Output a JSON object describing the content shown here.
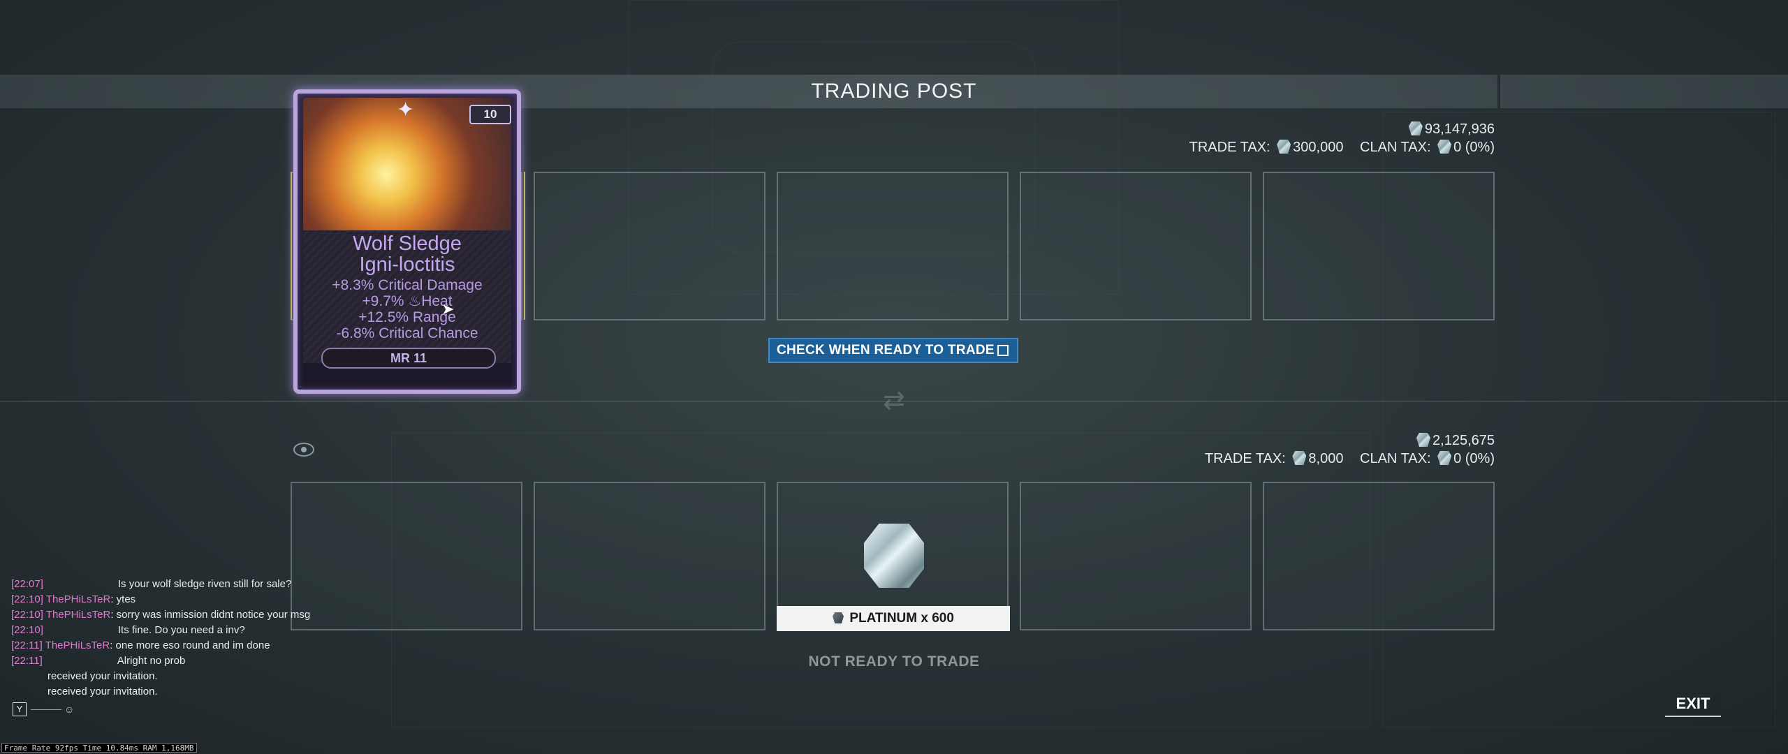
{
  "window": {
    "title": "TRADING POST"
  },
  "top_panel": {
    "balance": "93,147,936",
    "trade_tax_label": "TRADE TAX:",
    "trade_tax_value": "300,000",
    "clan_tax_label": "CLAN TAX:",
    "clan_tax_value": "0 (0%)"
  },
  "riven": {
    "rank": "10",
    "weapon": "Wolf Sledge",
    "mod_name": "Igni-loctitis",
    "stats": [
      "+8.3% Critical Damage",
      "+9.7% ♨Heat",
      "+12.5% Range",
      "-6.8% Critical Chance"
    ],
    "mastery": "MR 11"
  },
  "ready_button": {
    "label": "CHECK WHEN READY TO TRADE"
  },
  "bottom_panel": {
    "balance": "2,125,675",
    "trade_tax_label": "TRADE TAX:",
    "trade_tax_value": "8,000",
    "clan_tax_label": "CLAN TAX:",
    "clan_tax_value": "0 (0%)",
    "item_label": "PLATINUM x 600",
    "status": "NOT READY TO TRADE"
  },
  "exit_button": {
    "label": "EXIT"
  },
  "chat": [
    {
      "time": "[22:07]",
      "user": "",
      "msg": "Is your wolf sledge riven still for sale?"
    },
    {
      "time": "[22:10]",
      "user": "ThePHiLsTeR",
      "msg": ": ytes"
    },
    {
      "time": "[22:10]",
      "user": "ThePHiLsTeR",
      "msg": ": sorry was inmission didnt notice your msg"
    },
    {
      "time": "[22:10]",
      "user": "",
      "msg": "Its fine. Do you need a inv?"
    },
    {
      "time": "[22:11]",
      "user": "ThePHiLsTeR",
      "msg": ": one more eso round and im done"
    },
    {
      "time": "[22:11]",
      "user": "",
      "msg": "Alright no prob"
    },
    {
      "time": "",
      "user": "",
      "msg": "received your invitation."
    },
    {
      "time": "",
      "user": "",
      "msg": "received your invitation."
    }
  ],
  "chat_input": {
    "key": "Y"
  },
  "perf": {
    "text": "Frame Rate 92fps Time 10.84ms RAM 1,168MB"
  },
  "icons": {
    "currency": "platinum-icon",
    "item": "platinum-item-icon",
    "eye": "eye-icon",
    "trade": "trade-arrows-icon"
  }
}
